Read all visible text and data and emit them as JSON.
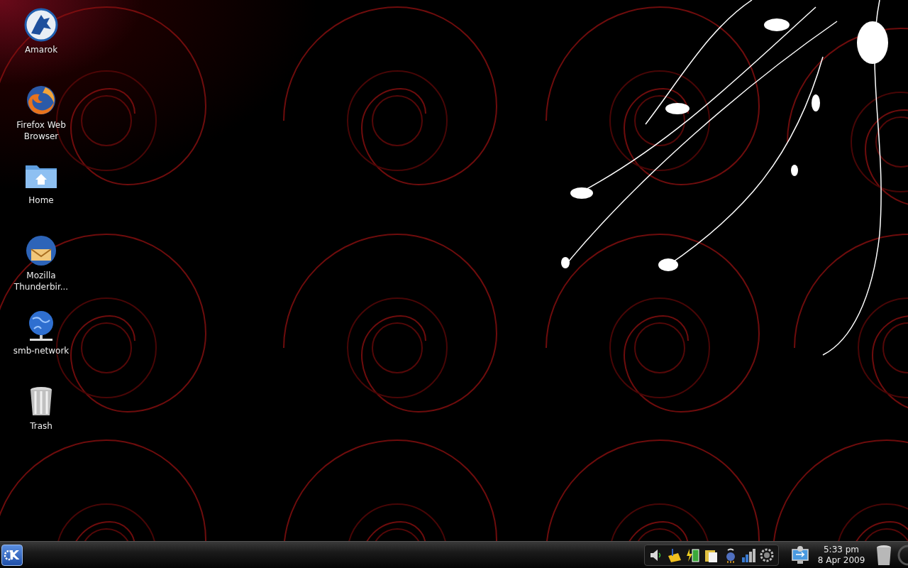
{
  "desktop_icons": [
    {
      "kind": "amarok",
      "label": "Amarok"
    },
    {
      "kind": "firefox",
      "label": "Firefox Web Browser"
    },
    {
      "kind": "home",
      "label": "Home"
    },
    {
      "kind": "thunderbird",
      "label": "Mozilla Thunderbir..."
    },
    {
      "kind": "network",
      "label": "smb-network"
    },
    {
      "kind": "trash",
      "label": "Trash"
    }
  ],
  "panel": {
    "launcher": {
      "logo_text": "K"
    },
    "tray": [
      {
        "kind": "speaker"
      },
      {
        "kind": "note"
      },
      {
        "kind": "battery"
      },
      {
        "kind": "clipboard"
      },
      {
        "kind": "network-manager"
      },
      {
        "kind": "signal"
      },
      {
        "kind": "gear"
      }
    ],
    "clock": {
      "time": "5:33 pm",
      "date": "8 Apr 2009"
    }
  }
}
